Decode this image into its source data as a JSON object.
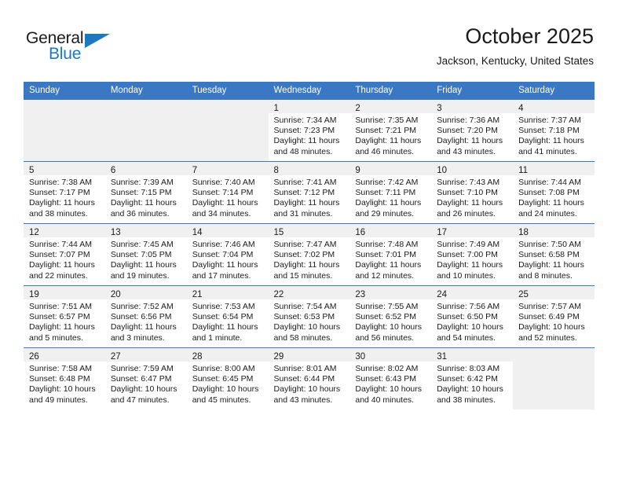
{
  "logo": {
    "text_primary": "General",
    "text_secondary": "Blue",
    "primary_color": "#1a1a1a",
    "secondary_color": "#1c79c0"
  },
  "header": {
    "title": "October 2025",
    "location": "Jackson, Kentucky, United States"
  },
  "theme": {
    "header_bg": "#3b78c3",
    "header_text": "#ffffff",
    "empty_cell_bg": "#f0f0f0",
    "daynum_band_bg": "#f0f0f0",
    "row_border": "#3b78c3",
    "body_text": "#1a1a1a"
  },
  "calendar": {
    "weekday_headers": [
      "Sunday",
      "Monday",
      "Tuesday",
      "Wednesday",
      "Thursday",
      "Friday",
      "Saturday"
    ],
    "weeks": [
      [
        {
          "empty": true
        },
        {
          "empty": true
        },
        {
          "empty": true
        },
        {
          "day": "1",
          "sunrise": "Sunrise: 7:34 AM",
          "sunset": "Sunset: 7:23 PM",
          "daylight": "Daylight: 11 hours and 48 minutes."
        },
        {
          "day": "2",
          "sunrise": "Sunrise: 7:35 AM",
          "sunset": "Sunset: 7:21 PM",
          "daylight": "Daylight: 11 hours and 46 minutes."
        },
        {
          "day": "3",
          "sunrise": "Sunrise: 7:36 AM",
          "sunset": "Sunset: 7:20 PM",
          "daylight": "Daylight: 11 hours and 43 minutes."
        },
        {
          "day": "4",
          "sunrise": "Sunrise: 7:37 AM",
          "sunset": "Sunset: 7:18 PM",
          "daylight": "Daylight: 11 hours and 41 minutes."
        }
      ],
      [
        {
          "day": "5",
          "sunrise": "Sunrise: 7:38 AM",
          "sunset": "Sunset: 7:17 PM",
          "daylight": "Daylight: 11 hours and 38 minutes."
        },
        {
          "day": "6",
          "sunrise": "Sunrise: 7:39 AM",
          "sunset": "Sunset: 7:15 PM",
          "daylight": "Daylight: 11 hours and 36 minutes."
        },
        {
          "day": "7",
          "sunrise": "Sunrise: 7:40 AM",
          "sunset": "Sunset: 7:14 PM",
          "daylight": "Daylight: 11 hours and 34 minutes."
        },
        {
          "day": "8",
          "sunrise": "Sunrise: 7:41 AM",
          "sunset": "Sunset: 7:12 PM",
          "daylight": "Daylight: 11 hours and 31 minutes."
        },
        {
          "day": "9",
          "sunrise": "Sunrise: 7:42 AM",
          "sunset": "Sunset: 7:11 PM",
          "daylight": "Daylight: 11 hours and 29 minutes."
        },
        {
          "day": "10",
          "sunrise": "Sunrise: 7:43 AM",
          "sunset": "Sunset: 7:10 PM",
          "daylight": "Daylight: 11 hours and 26 minutes."
        },
        {
          "day": "11",
          "sunrise": "Sunrise: 7:44 AM",
          "sunset": "Sunset: 7:08 PM",
          "daylight": "Daylight: 11 hours and 24 minutes."
        }
      ],
      [
        {
          "day": "12",
          "sunrise": "Sunrise: 7:44 AM",
          "sunset": "Sunset: 7:07 PM",
          "daylight": "Daylight: 11 hours and 22 minutes."
        },
        {
          "day": "13",
          "sunrise": "Sunrise: 7:45 AM",
          "sunset": "Sunset: 7:05 PM",
          "daylight": "Daylight: 11 hours and 19 minutes."
        },
        {
          "day": "14",
          "sunrise": "Sunrise: 7:46 AM",
          "sunset": "Sunset: 7:04 PM",
          "daylight": "Daylight: 11 hours and 17 minutes."
        },
        {
          "day": "15",
          "sunrise": "Sunrise: 7:47 AM",
          "sunset": "Sunset: 7:02 PM",
          "daylight": "Daylight: 11 hours and 15 minutes."
        },
        {
          "day": "16",
          "sunrise": "Sunrise: 7:48 AM",
          "sunset": "Sunset: 7:01 PM",
          "daylight": "Daylight: 11 hours and 12 minutes."
        },
        {
          "day": "17",
          "sunrise": "Sunrise: 7:49 AM",
          "sunset": "Sunset: 7:00 PM",
          "daylight": "Daylight: 11 hours and 10 minutes."
        },
        {
          "day": "18",
          "sunrise": "Sunrise: 7:50 AM",
          "sunset": "Sunset: 6:58 PM",
          "daylight": "Daylight: 11 hours and 8 minutes."
        }
      ],
      [
        {
          "day": "19",
          "sunrise": "Sunrise: 7:51 AM",
          "sunset": "Sunset: 6:57 PM",
          "daylight": "Daylight: 11 hours and 5 minutes."
        },
        {
          "day": "20",
          "sunrise": "Sunrise: 7:52 AM",
          "sunset": "Sunset: 6:56 PM",
          "daylight": "Daylight: 11 hours and 3 minutes."
        },
        {
          "day": "21",
          "sunrise": "Sunrise: 7:53 AM",
          "sunset": "Sunset: 6:54 PM",
          "daylight": "Daylight: 11 hours and 1 minute."
        },
        {
          "day": "22",
          "sunrise": "Sunrise: 7:54 AM",
          "sunset": "Sunset: 6:53 PM",
          "daylight": "Daylight: 10 hours and 58 minutes."
        },
        {
          "day": "23",
          "sunrise": "Sunrise: 7:55 AM",
          "sunset": "Sunset: 6:52 PM",
          "daylight": "Daylight: 10 hours and 56 minutes."
        },
        {
          "day": "24",
          "sunrise": "Sunrise: 7:56 AM",
          "sunset": "Sunset: 6:50 PM",
          "daylight": "Daylight: 10 hours and 54 minutes."
        },
        {
          "day": "25",
          "sunrise": "Sunrise: 7:57 AM",
          "sunset": "Sunset: 6:49 PM",
          "daylight": "Daylight: 10 hours and 52 minutes."
        }
      ],
      [
        {
          "day": "26",
          "sunrise": "Sunrise: 7:58 AM",
          "sunset": "Sunset: 6:48 PM",
          "daylight": "Daylight: 10 hours and 49 minutes."
        },
        {
          "day": "27",
          "sunrise": "Sunrise: 7:59 AM",
          "sunset": "Sunset: 6:47 PM",
          "daylight": "Daylight: 10 hours and 47 minutes."
        },
        {
          "day": "28",
          "sunrise": "Sunrise: 8:00 AM",
          "sunset": "Sunset: 6:45 PM",
          "daylight": "Daylight: 10 hours and 45 minutes."
        },
        {
          "day": "29",
          "sunrise": "Sunrise: 8:01 AM",
          "sunset": "Sunset: 6:44 PM",
          "daylight": "Daylight: 10 hours and 43 minutes."
        },
        {
          "day": "30",
          "sunrise": "Sunrise: 8:02 AM",
          "sunset": "Sunset: 6:43 PM",
          "daylight": "Daylight: 10 hours and 40 minutes."
        },
        {
          "day": "31",
          "sunrise": "Sunrise: 8:03 AM",
          "sunset": "Sunset: 6:42 PM",
          "daylight": "Daylight: 10 hours and 38 minutes."
        },
        {
          "empty": true
        }
      ]
    ]
  }
}
